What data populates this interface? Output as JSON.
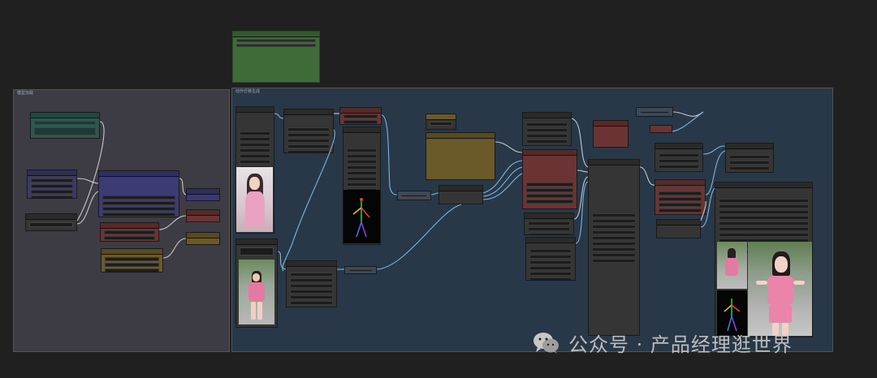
{
  "watermark": {
    "icon": "wechat-icon",
    "text": "公众号 · 产品经理逛世界"
  },
  "groups": {
    "left_title": "模型加载",
    "right_title": "动作迁移生成"
  },
  "colors": {
    "canvas_bg": "#202020",
    "left_group_bg": "#3d3c44",
    "right_group_bg": "#283848",
    "link_blue": "#7fb4e0",
    "link_gray": "#c8c8c8"
  },
  "images": {
    "reference_portrait": "pink-dress-portrait",
    "walking_frame": "walking-street-frame",
    "pose_skeleton": "openpose-skeleton",
    "output_main": "output-walking-girl"
  }
}
